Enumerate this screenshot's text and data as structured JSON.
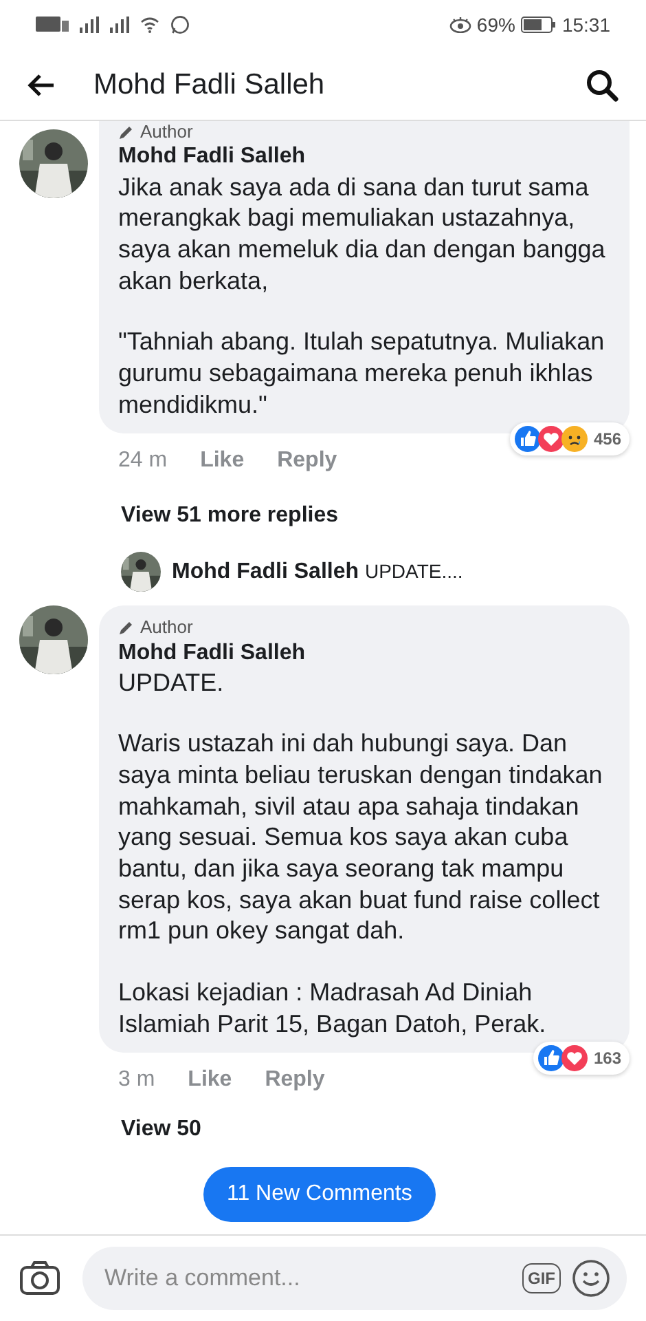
{
  "status_bar": {
    "battery_text": "69%",
    "time": "15:31"
  },
  "header": {
    "title": "Mohd Fadli Salleh"
  },
  "comments": [
    {
      "badge": "Author",
      "author": "Mohd Fadli Salleh",
      "paragraphs": [
        "Jika anak saya ada di sana dan turut sama merangkak bagi memuliakan ustazahnya, saya akan memeluk dia dan dengan bangga akan berkata,",
        "\"Tahniah abang. Itulah sepatutnya. Muliakan gurumu sebagaimana mereka penuh ikhlas mendidikmu.\""
      ],
      "time": "24 m",
      "like": "Like",
      "reply": "Reply",
      "reactions": [
        {
          "kind": "like"
        },
        {
          "kind": "love"
        },
        {
          "kind": "sad"
        }
      ],
      "reaction_count": "456",
      "view_replies": "View 51 more replies",
      "reply_preview": {
        "author": "Mohd Fadli Salleh",
        "text": "UPDATE...."
      }
    },
    {
      "badge": "Author",
      "author": "Mohd Fadli Salleh",
      "paragraphs": [
        "UPDATE.",
        "Waris ustazah ini dah hubungi saya. Dan saya minta beliau teruskan dengan tindakan mahkamah, sivil atau apa sahaja tindakan yang sesuai. Semua kos saya akan cuba bantu, dan jika saya seorang tak mampu serap kos, saya akan buat fund raise collect rm1 pun okey sangat dah.",
        "Lokasi kejadian : Madrasah Ad Diniah Islamiah Parit 15, Bagan Datoh, Perak."
      ],
      "time": "3 m",
      "like": "Like",
      "reply": "Reply",
      "reactions": [
        {
          "kind": "like"
        },
        {
          "kind": "love"
        }
      ],
      "reaction_count": "163",
      "view_replies": "View 50"
    }
  ],
  "new_comments_pill": "11 New Comments",
  "composer": {
    "placeholder": "Write a comment...",
    "gif_label": "GIF"
  }
}
